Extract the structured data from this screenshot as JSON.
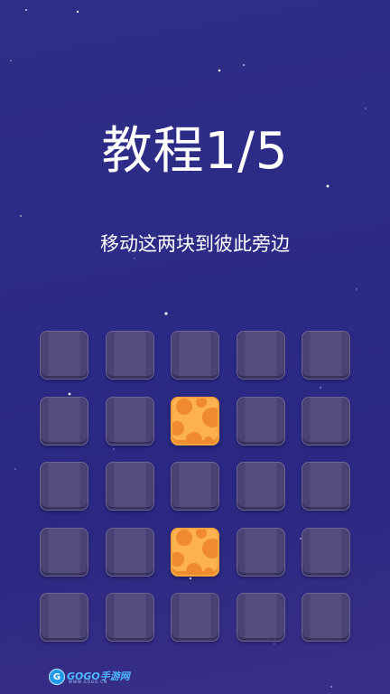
{
  "tutorial": {
    "title": "教程1/5",
    "instruction": "移动这两块到彼此旁边"
  },
  "board": {
    "rows": 5,
    "cols": 5,
    "blocks": [
      {
        "row": 1,
        "col": 2
      },
      {
        "row": 3,
        "col": 2
      }
    ]
  },
  "watermark": {
    "logo_letter": "G",
    "text": "GOGO手游网",
    "url": "WWW.GOGO.CN"
  },
  "colors": {
    "background": "#2b2a86",
    "empty_tile": "#554d7c",
    "block": "#fdb14f",
    "block_spot": "#f08a2e"
  }
}
